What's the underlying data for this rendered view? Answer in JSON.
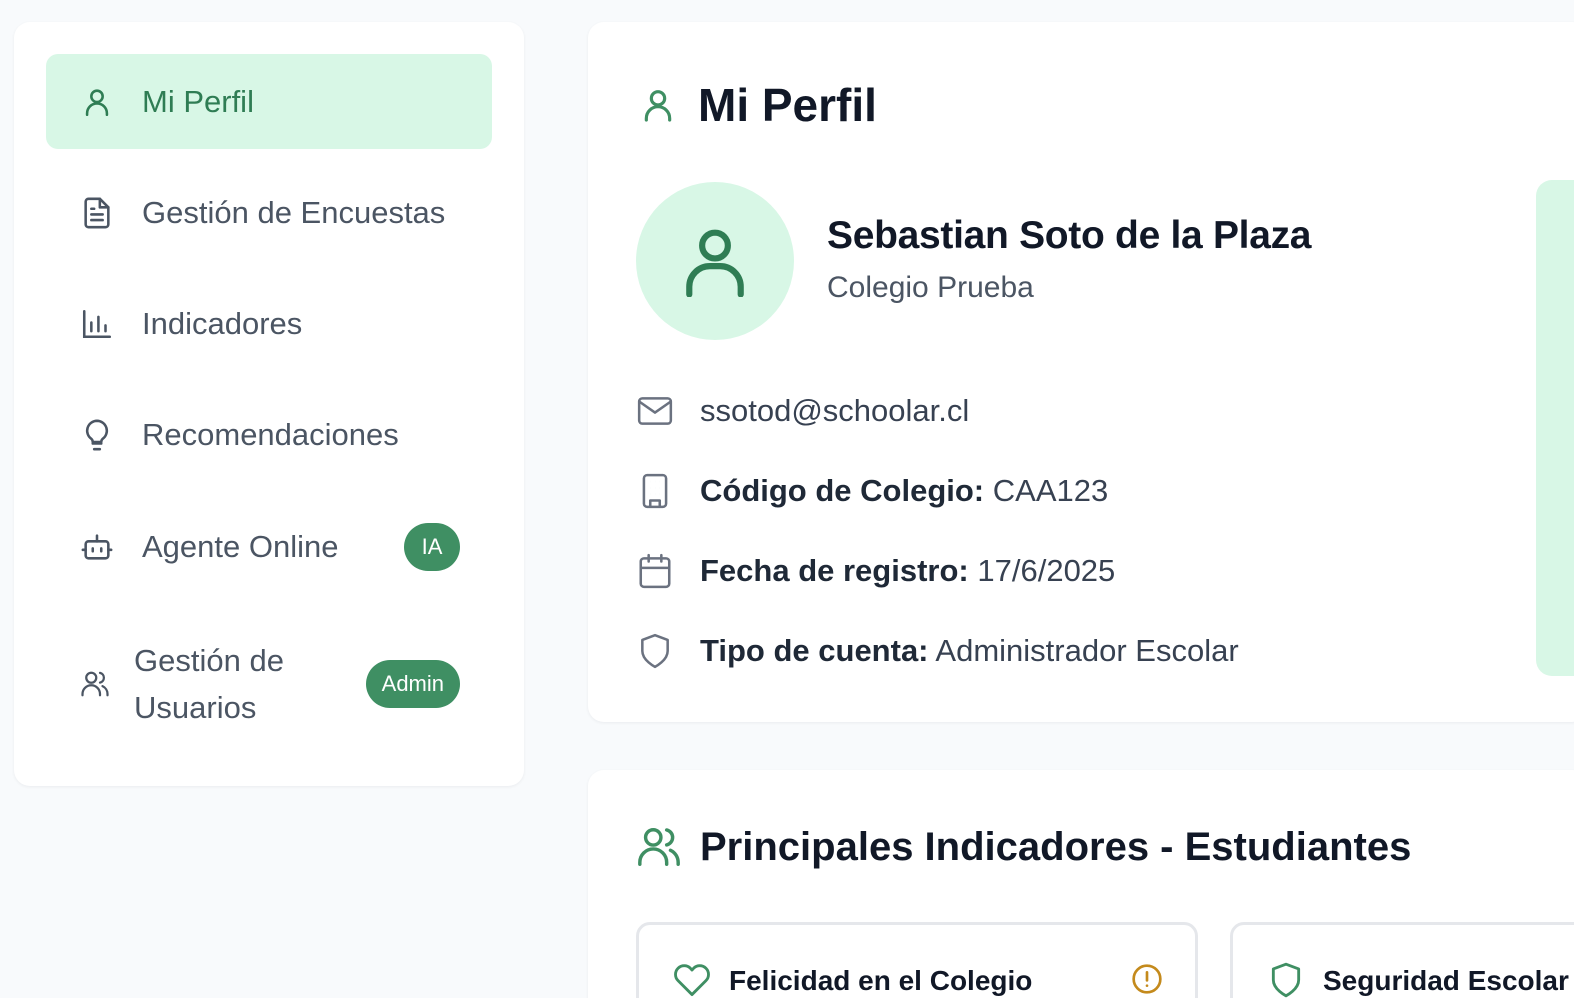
{
  "sidebar": {
    "items": [
      {
        "label": "Mi Perfil",
        "icon": "user-icon",
        "active": true
      },
      {
        "label": "Gestión de Encuestas",
        "icon": "document-icon"
      },
      {
        "label": "Indicadores",
        "icon": "bar-chart-icon"
      },
      {
        "label": "Recomendaciones",
        "icon": "lightbulb-icon"
      },
      {
        "label": "Agente Online",
        "icon": "robot-icon",
        "badge": "IA"
      },
      {
        "label": "Gestión de Usuarios",
        "icon": "users-icon",
        "badge": "Admin"
      }
    ]
  },
  "profile": {
    "title": "Mi Perfil",
    "name": "Sebastian Soto de la Plaza",
    "school": "Colegio Prueba",
    "email": "ssotod@schoolar.cl",
    "school_code_label": "Código de Colegio:",
    "school_code": "CAA123",
    "registration_label": "Fecha de registro:",
    "registration_date": "17/6/2025",
    "account_type_label": "Tipo de cuenta:",
    "account_type": "Administrador Escolar"
  },
  "indicators": {
    "title": "Principales Indicadores - Estudiantes",
    "cards": [
      {
        "label": "Felicidad en el Colegio",
        "icon": "heart-icon",
        "status_icon": "alert-circle-icon"
      },
      {
        "label": "Seguridad Escolar",
        "icon": "shield-icon"
      }
    ]
  },
  "colors": {
    "accent": "#3f8f63",
    "accent_light": "#d8f7e6",
    "warning": "#c48a1c"
  }
}
